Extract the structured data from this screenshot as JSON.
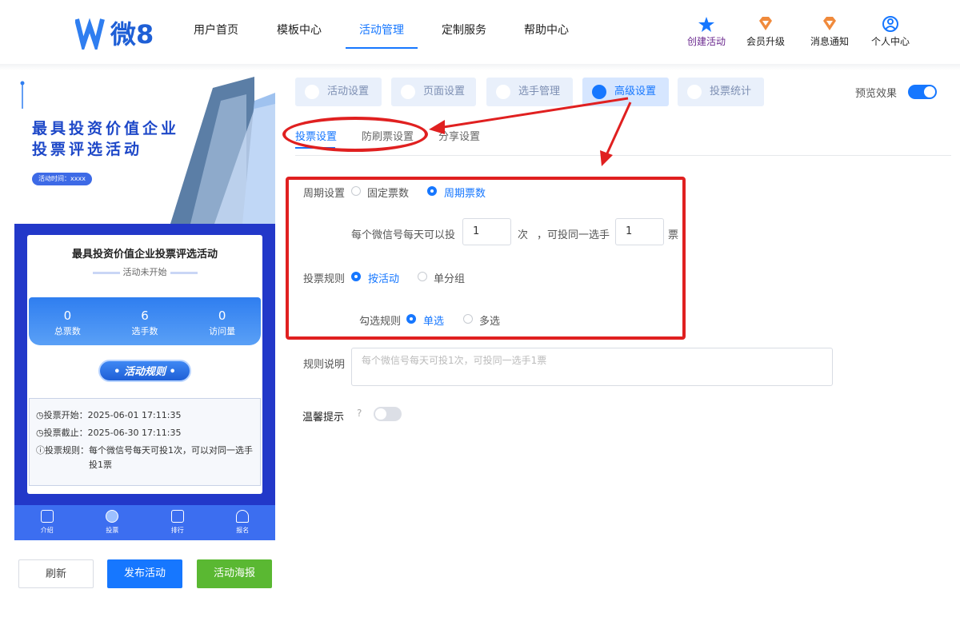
{
  "header": {
    "logo_text": "微8",
    "nav": [
      "用户首页",
      "模板中心",
      "活动管理",
      "定制服务",
      "帮助中心"
    ],
    "active_nav": "活动管理",
    "tools": [
      {
        "label": "创建活动",
        "icon": "star-icon",
        "color": "#1677ff"
      },
      {
        "label": "会员升级",
        "icon": "diamond-icon",
        "color": "#f08a3c"
      },
      {
        "label": "消息通知",
        "icon": "bell-icon",
        "color": "#f08a3c"
      },
      {
        "label": "个人中心",
        "icon": "user-icon",
        "color": "#1677ff"
      }
    ]
  },
  "preview": {
    "banner_title_1": "最具投资价值企业",
    "banner_title_2": "投票评选活动",
    "banner_badge": "活动时间：xxxx",
    "card_title": "最具投资价值企业投票评选活动",
    "card_status": "活动未开始",
    "stats": [
      {
        "value": "0",
        "label": "总票数"
      },
      {
        "value": "6",
        "label": "选手数"
      },
      {
        "value": "0",
        "label": "访问量"
      }
    ],
    "rules_button": "活动规则",
    "rules": [
      {
        "icon": "clock-icon",
        "key": "投票开始：",
        "value": "2025-06-01 17:11:35"
      },
      {
        "icon": "clock-icon",
        "key": "投票截止：",
        "value": "2025-06-30 17:11:35"
      },
      {
        "icon": "info-icon",
        "key": "投票规则：",
        "value": "每个微信号每天可投1次，可以对同一选手投1票"
      }
    ],
    "tabbar": [
      "介绍",
      "投票",
      "排行",
      "报名"
    ]
  },
  "actions": {
    "refresh": "刷新",
    "publish": "发布活动",
    "poster": "活动海报"
  },
  "steps": [
    {
      "label": "活动设置",
      "icon": "shield-icon"
    },
    {
      "label": "页面设置",
      "icon": "page-icon"
    },
    {
      "label": "选手管理",
      "icon": "person-icon"
    },
    {
      "label": "高级设置",
      "icon": "settings-icon"
    },
    {
      "label": "投票统计",
      "icon": "chart-icon"
    }
  ],
  "active_step": "高级设置",
  "preview_toggle_label": "预览效果",
  "sub_tabs": [
    "投票设置",
    "防刷票设置",
    "分享设置"
  ],
  "active_sub_tab": "投票设置",
  "form": {
    "cycle_label": "周期设置",
    "cycle_options": [
      "固定票数",
      "周期票数"
    ],
    "cycle_selected": "周期票数",
    "daily_prefix": "每个微信号每天可以投",
    "daily_value": "1",
    "daily_unit": "次",
    "same_prefix": "，可投同一选手",
    "same_value": "1",
    "same_unit": "票",
    "rule_label": "投票规则",
    "rule_options": [
      "按活动",
      "单分组"
    ],
    "rule_selected": "按活动",
    "check_label": "勾选规则",
    "check_options": [
      "单选",
      "多选"
    ],
    "check_selected": "单选",
    "desc_label": "规则说明",
    "desc_placeholder": "每个微信号每天可投1次，可投同一选手1票",
    "tip_label": "温馨提示"
  }
}
